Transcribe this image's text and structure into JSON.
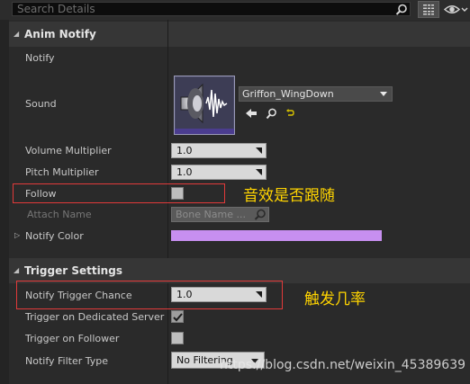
{
  "search": {
    "placeholder": "Search Details"
  },
  "sections": {
    "anim_notify": {
      "title": "Anim Notify",
      "notify_label": "Notify",
      "sound_label": "Sound",
      "sound_asset": "Griffon_WingDown",
      "volume_label": "Volume Multiplier",
      "volume_value": "1.0",
      "pitch_label": "Pitch Multiplier",
      "pitch_value": "1.0",
      "follow_label": "Follow",
      "follow_checked": false,
      "attach_label": "Attach Name",
      "attach_placeholder": "Bone Name ...",
      "color_label": "Notify Color",
      "color_value": "#c78ff0"
    },
    "trigger_settings": {
      "title": "Trigger Settings",
      "chance_label": "Notify Trigger Chance",
      "chance_value": "1.0",
      "dedicated_label": "Trigger on Dedicated Server",
      "dedicated_checked": true,
      "follower_label": "Trigger on Follower",
      "follower_checked": false,
      "filter_label": "Notify Filter Type",
      "filter_value": "No Filtering"
    }
  },
  "annotations": {
    "follow_note": "音效是否跟随",
    "chance_note": "触发几率"
  },
  "watermark": "https://blog.csdn.net/weixin_45389639"
}
